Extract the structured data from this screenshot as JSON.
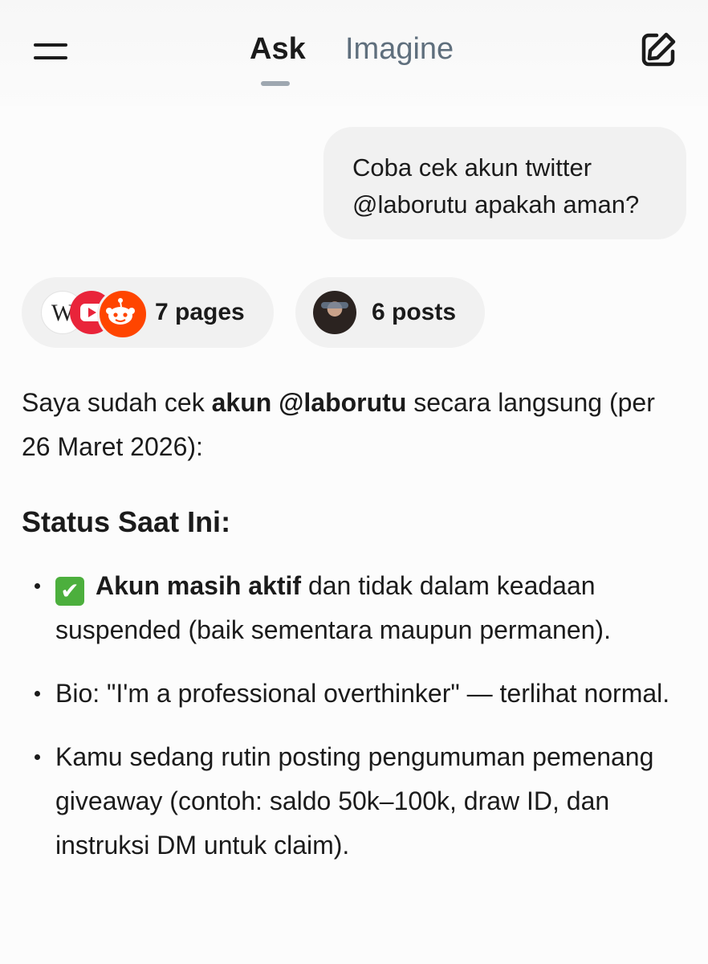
{
  "header": {
    "tabs": [
      {
        "label": "Ask",
        "active": true
      },
      {
        "label": "Imagine",
        "active": false
      }
    ],
    "menu_icon": "hamburger-menu-icon",
    "edit_icon": "new-chat-edit-icon",
    "active_color": "#1b1b1b",
    "inactive_color": "#5f6f7d"
  },
  "user_message": {
    "line1": "Coba cek akun twitter",
    "line2": "@laborutu apakah aman?"
  },
  "sources": {
    "pages": {
      "label": "7 pages",
      "favicons": [
        "wikipedia-icon",
        "youtube-icon",
        "reddit-icon"
      ],
      "wiki_letter": "W"
    },
    "posts": {
      "label": "6 posts",
      "avatar": "user-avatar"
    }
  },
  "response": {
    "intro_before": "Saya sudah cek ",
    "intro_bold": "akun @laborutu",
    "intro_after": " secara langsung (per 26 Maret 2026):",
    "heading": "Status Saat Ini:",
    "bullets": [
      {
        "emoji": "✔",
        "bold": "Akun masih aktif",
        "text": " dan tidak dalam keadaan suspended (baik sementara maupun permanen)."
      },
      {
        "text": "Bio: \"I'm a professional overthinker\" — terlihat normal."
      },
      {
        "text": "Kamu sedang rutin posting pengumuman pemenang giveaway (contoh: saldo 50k–100k, draw ID, dan instruksi DM untuk claim)."
      }
    ]
  }
}
